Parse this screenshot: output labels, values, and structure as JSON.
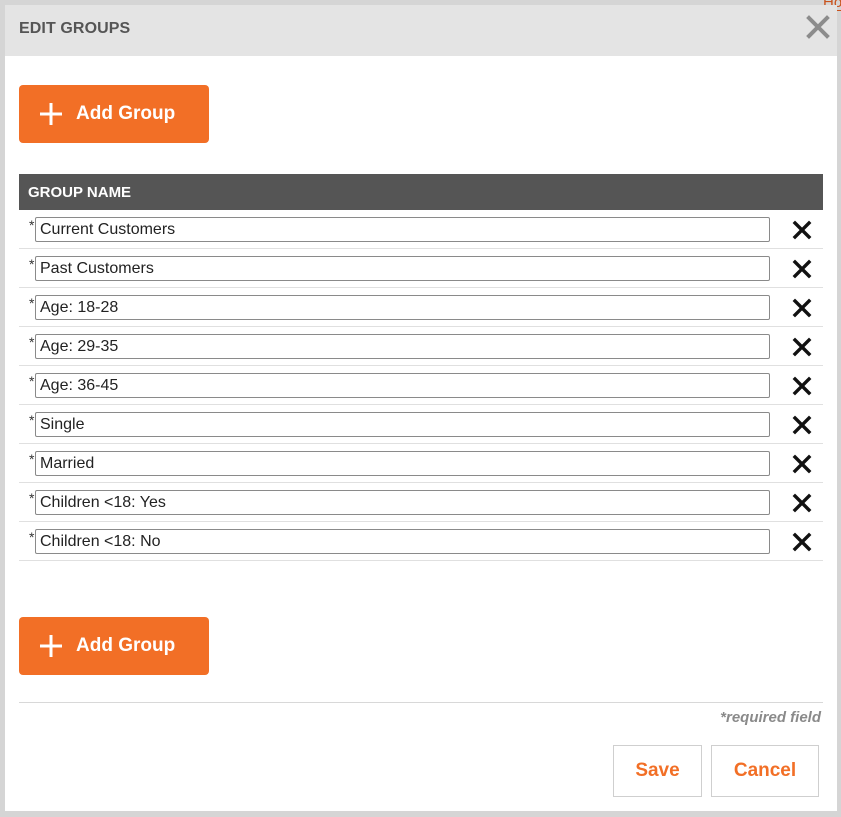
{
  "background_peek_text": "Ho",
  "dialog": {
    "title": "EDIT GROUPS",
    "close_icon": "close-icon"
  },
  "add_group_label": "Add Group",
  "table": {
    "header": "GROUP NAME",
    "required_marker": "*",
    "rows": [
      {
        "value": "Current Customers"
      },
      {
        "value": "Past Customers"
      },
      {
        "value": "Age: 18-28"
      },
      {
        "value": "Age: 29-35"
      },
      {
        "value": "Age: 36-45"
      },
      {
        "value": "Single"
      },
      {
        "value": "Married"
      },
      {
        "value": "Children <18: Yes"
      },
      {
        "value": "Children <18: No"
      }
    ]
  },
  "footer": {
    "required_note": "*required field",
    "save_label": "Save",
    "cancel_label": "Cancel"
  },
  "colors": {
    "accent": "#f26f26",
    "header_bg": "#555555",
    "titlebar_bg": "#e4e4e4"
  }
}
